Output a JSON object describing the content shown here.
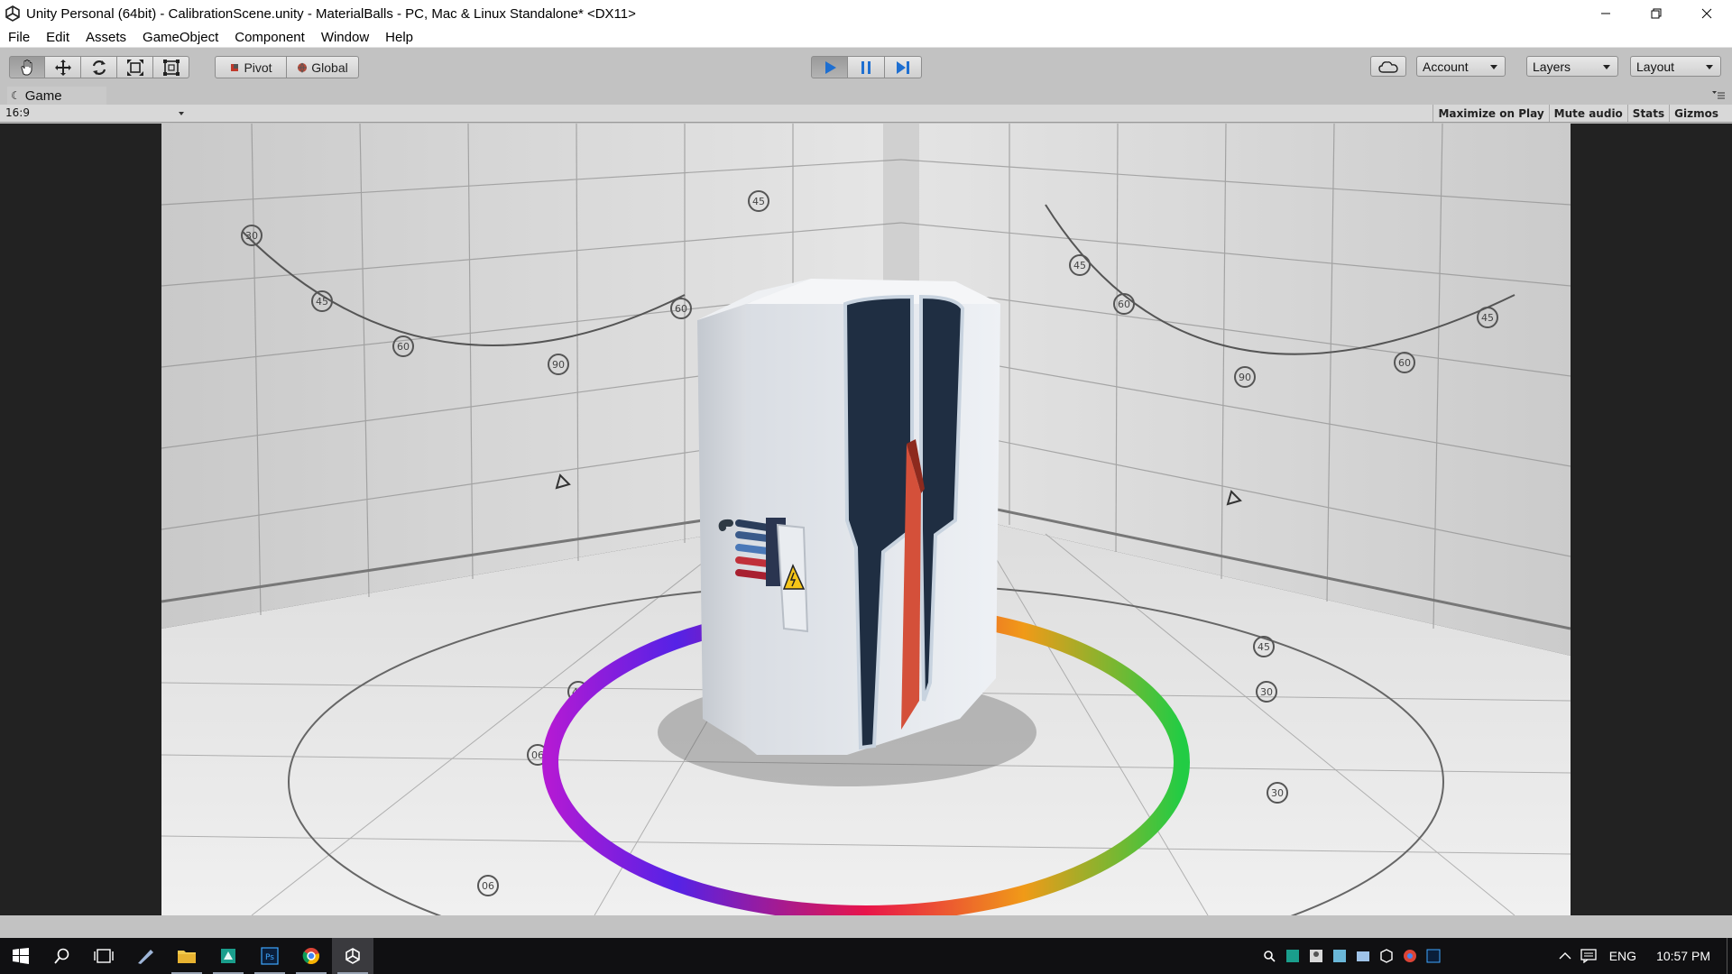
{
  "window": {
    "title": "Unity Personal (64bit) - CalibrationScene.unity - MaterialBalls - PC, Mac & Linux Standalone* <DX11>",
    "icon": "unity-logo-icon"
  },
  "menu": [
    "File",
    "Edit",
    "Assets",
    "GameObject",
    "Component",
    "Window",
    "Help"
  ],
  "toolbar": {
    "transform_tools": [
      "hand-tool",
      "move-tool",
      "rotate-tool",
      "scale-tool",
      "rect-tool"
    ],
    "pivot_label": "Pivot",
    "global_label": "Global",
    "play_controls": [
      "play",
      "pause",
      "step"
    ],
    "play_active": true,
    "account_label": "Account",
    "layers_label": "Layers",
    "layout_label": "Layout"
  },
  "game_view": {
    "tab_label": "Game",
    "aspect_label": "16:9",
    "buttons": [
      "Maximize on Play",
      "Mute audio",
      "Stats",
      "Gizmos"
    ]
  },
  "scene": {
    "wall_markers_left": [
      "30",
      "45",
      "60",
      "90",
      "60",
      "45"
    ],
    "wall_markers_right": [
      "60",
      "45",
      "90",
      "60",
      "45"
    ],
    "floor_markers": [
      "06",
      "45",
      "30",
      "45",
      "30",
      "06"
    ]
  },
  "taskbar": {
    "apps": [
      "windows-start",
      "search",
      "task-view",
      "file-explorer",
      "folder",
      "store",
      "photoshop",
      "chrome",
      "unity"
    ],
    "language": "ENG",
    "time": "10:57 PM",
    "colors": {
      "accent": "#2f7fd8",
      "taskbar": "#101012"
    }
  }
}
